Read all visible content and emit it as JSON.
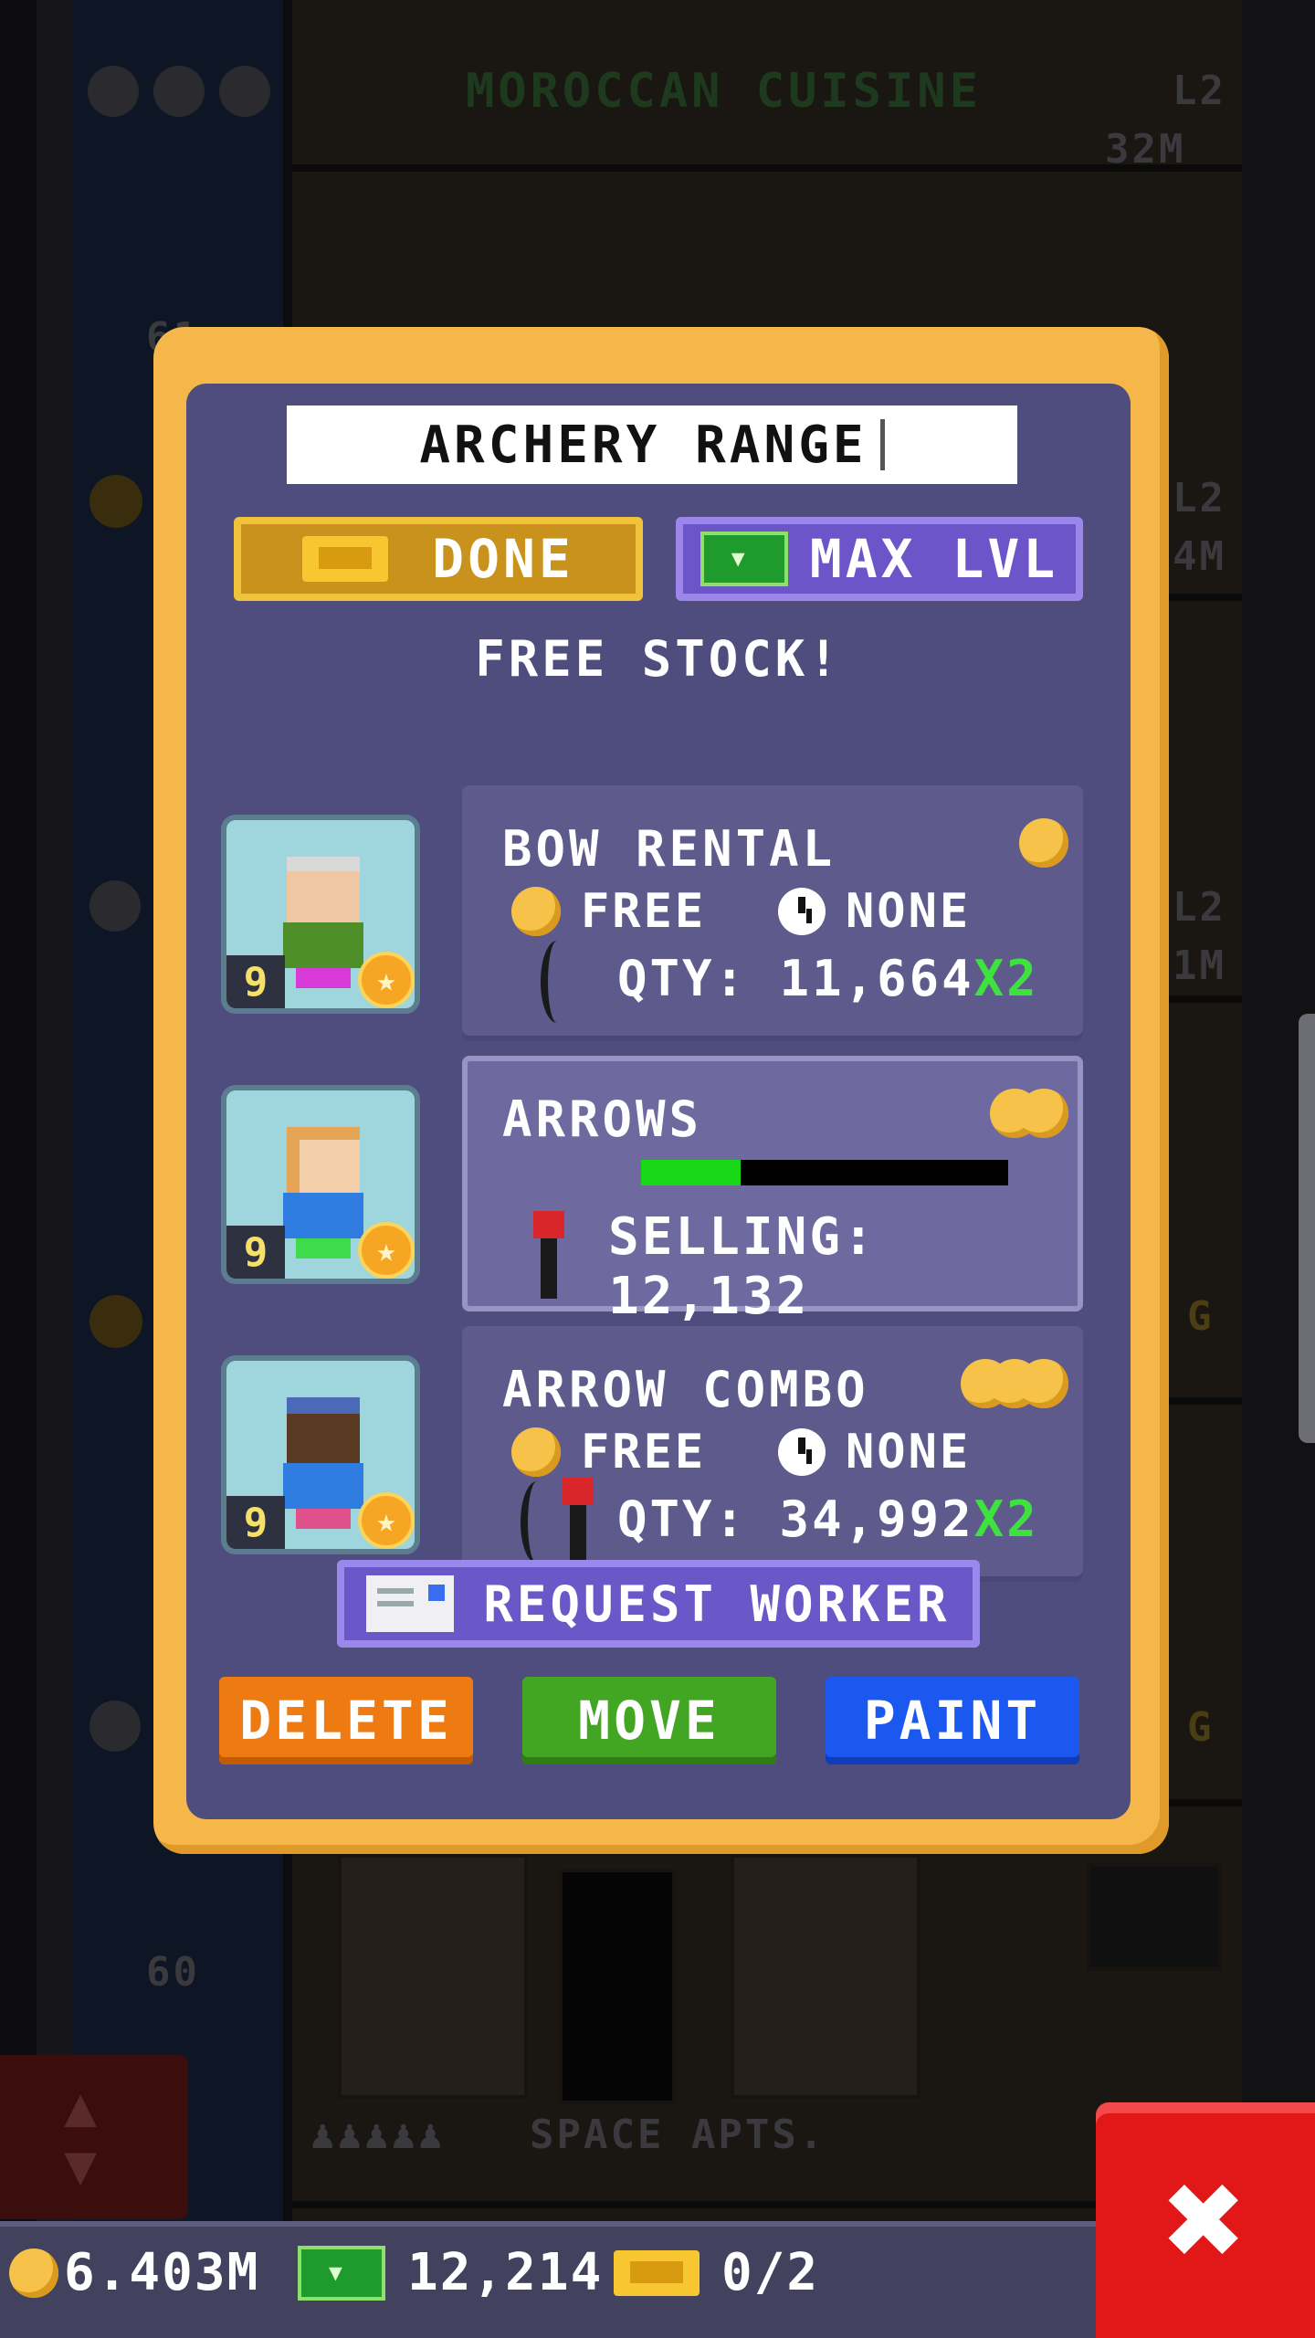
{
  "background": {
    "floor_top": {
      "name": "MOROCCAN CUISINE",
      "level": "L2",
      "value": "32M"
    },
    "floor_bottom": {
      "name": "SPACE APTS."
    },
    "floor_numbers": [
      "61",
      "60"
    ],
    "side_levels": [
      "L2",
      "4M",
      "L2",
      "1M"
    ],
    "side_letters": [
      "G",
      "G"
    ]
  },
  "dialog": {
    "name_value": "ARCHERY RANGE",
    "done_label": "DONE",
    "max_label": "MAX LVL",
    "free_stock_label": "FREE STOCK!",
    "items": [
      {
        "title": "BOW RENTAL",
        "price_option": "FREE",
        "time_option": "NONE",
        "qty": "QTY: 11,664",
        "multiplier": "X2",
        "coins": 1,
        "worker_level": "9"
      },
      {
        "title": "ARROWS",
        "selling": "SELLING: 12,132",
        "progress": 0.27,
        "coins": 2,
        "worker_level": "9"
      },
      {
        "title": "ARROW COMBO",
        "price_option": "FREE",
        "time_option": "NONE",
        "qty": "QTY: 34,992",
        "multiplier": "X2",
        "coins": 3,
        "worker_level": "9"
      }
    ],
    "request_worker_label": "REQUEST WORKER",
    "delete_label": "DELETE",
    "move_label": "MOVE",
    "paint_label": "PAINT"
  },
  "hud": {
    "coins": "6.403M",
    "bux": "12,214",
    "tickets": "0/2"
  },
  "icons": {
    "close": "close-icon",
    "coin": "coin-icon",
    "clock": "clock-icon",
    "ticket": "ticket-icon",
    "bux": "bux-icon",
    "mail": "mail-icon"
  },
  "colors": {
    "dialog_border": "#f5b64a",
    "dialog_panel": "#4f4d7e",
    "done": "#c8921c",
    "max_lvl": "#6b55c8",
    "delete": "#ee7a12",
    "move": "#42a622",
    "paint": "#1a58f0",
    "progress": "#18d818",
    "multiplier": "#3ee23e",
    "close": "#e21818"
  }
}
